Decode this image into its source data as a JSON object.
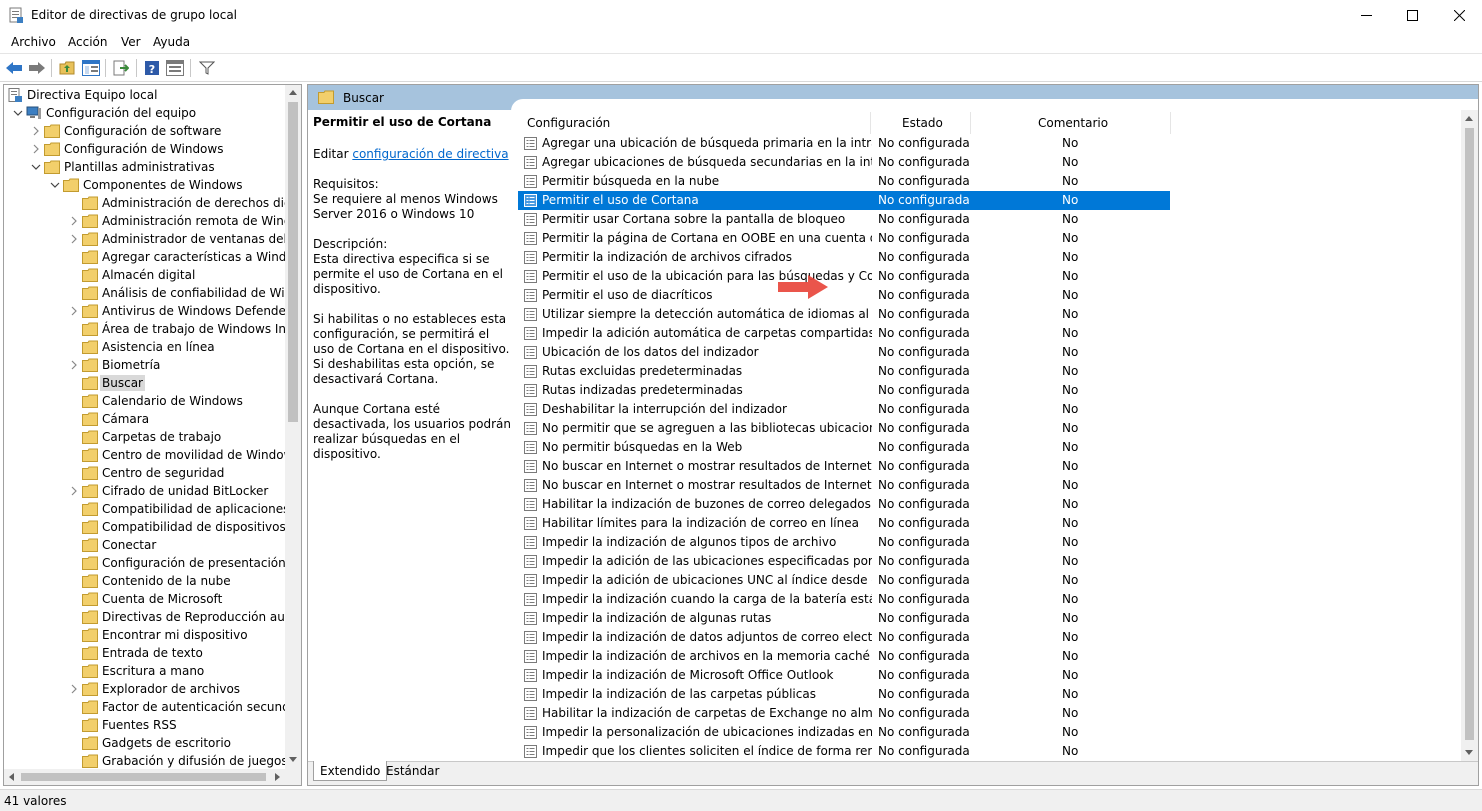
{
  "window": {
    "title": "Editor de directivas de grupo local"
  },
  "menu": [
    "Archivo",
    "Acción",
    "Ver",
    "Ayuda"
  ],
  "toolbar_icons": [
    "back-arrow-icon",
    "forward-arrow-icon",
    "folder-up-icon",
    "show-hide-tree-icon",
    "export-list-icon",
    "help-icon",
    "properties-icon",
    "filter-icon"
  ],
  "tree": {
    "items": [
      {
        "label": "Directiva Equipo local",
        "level": 0,
        "expander": "none",
        "icon": "computer-policy-icon"
      },
      {
        "label": "Configuración del equipo",
        "level": 1,
        "expander": "open",
        "icon": "computer-icon"
      },
      {
        "label": "Configuración de software",
        "level": 2,
        "expander": "closed",
        "icon": "folder-icon"
      },
      {
        "label": "Configuración de Windows",
        "level": 2,
        "expander": "closed",
        "icon": "folder-icon"
      },
      {
        "label": "Plantillas administrativas",
        "level": 2,
        "expander": "open",
        "icon": "folder-icon"
      },
      {
        "label": "Componentes de Windows",
        "level": 3,
        "expander": "open",
        "icon": "folder-icon"
      },
      {
        "label": "Administración de derechos digita",
        "level": 4,
        "expander": "none",
        "icon": "folder-icon"
      },
      {
        "label": "Administración remota de Window",
        "level": 4,
        "expander": "closed",
        "icon": "folder-icon"
      },
      {
        "label": "Administrador de ventanas del esc",
        "level": 4,
        "expander": "closed",
        "icon": "folder-icon"
      },
      {
        "label": "Agregar características a Windows",
        "level": 4,
        "expander": "none",
        "icon": "folder-icon"
      },
      {
        "label": "Almacén digital",
        "level": 4,
        "expander": "none",
        "icon": "folder-icon"
      },
      {
        "label": "Análisis de confiabilidad de Windo",
        "level": 4,
        "expander": "none",
        "icon": "folder-icon"
      },
      {
        "label": "Antivirus de Windows Defender",
        "level": 4,
        "expander": "closed",
        "icon": "folder-icon"
      },
      {
        "label": "Área de trabajo de Windows Ink",
        "level": 4,
        "expander": "none",
        "icon": "folder-icon"
      },
      {
        "label": "Asistencia en línea",
        "level": 4,
        "expander": "none",
        "icon": "folder-icon"
      },
      {
        "label": "Biometría",
        "level": 4,
        "expander": "closed",
        "icon": "folder-icon"
      },
      {
        "label": "Buscar",
        "level": 4,
        "expander": "none",
        "icon": "folder-icon",
        "selected": true
      },
      {
        "label": "Calendario de Windows",
        "level": 4,
        "expander": "none",
        "icon": "folder-icon"
      },
      {
        "label": "Cámara",
        "level": 4,
        "expander": "none",
        "icon": "folder-icon"
      },
      {
        "label": "Carpetas de trabajo",
        "level": 4,
        "expander": "none",
        "icon": "folder-icon"
      },
      {
        "label": "Centro de movilidad de Windows",
        "level": 4,
        "expander": "none",
        "icon": "folder-icon"
      },
      {
        "label": "Centro de seguridad",
        "level": 4,
        "expander": "none",
        "icon": "folder-icon"
      },
      {
        "label": "Cifrado de unidad BitLocker",
        "level": 4,
        "expander": "closed",
        "icon": "folder-icon"
      },
      {
        "label": "Compatibilidad de aplicaciones",
        "level": 4,
        "expander": "none",
        "icon": "folder-icon"
      },
      {
        "label": "Compatibilidad de dispositivos y c",
        "level": 4,
        "expander": "none",
        "icon": "folder-icon"
      },
      {
        "label": "Conectar",
        "level": 4,
        "expander": "none",
        "icon": "folder-icon"
      },
      {
        "label": "Configuración de presentación",
        "level": 4,
        "expander": "none",
        "icon": "folder-icon"
      },
      {
        "label": "Contenido de la nube",
        "level": 4,
        "expander": "none",
        "icon": "folder-icon"
      },
      {
        "label": "Cuenta de Microsoft",
        "level": 4,
        "expander": "none",
        "icon": "folder-icon"
      },
      {
        "label": "Directivas de Reproducción autom",
        "level": 4,
        "expander": "none",
        "icon": "folder-icon"
      },
      {
        "label": "Encontrar mi dispositivo",
        "level": 4,
        "expander": "none",
        "icon": "folder-icon"
      },
      {
        "label": "Entrada de texto",
        "level": 4,
        "expander": "none",
        "icon": "folder-icon"
      },
      {
        "label": "Escritura a mano",
        "level": 4,
        "expander": "none",
        "icon": "folder-icon"
      },
      {
        "label": "Explorador de archivos",
        "level": 4,
        "expander": "closed",
        "icon": "folder-icon"
      },
      {
        "label": "Factor de autenticación secundari",
        "level": 4,
        "expander": "none",
        "icon": "folder-icon"
      },
      {
        "label": "Fuentes RSS",
        "level": 4,
        "expander": "none",
        "icon": "folder-icon"
      },
      {
        "label": "Gadgets de escritorio",
        "level": 4,
        "expander": "none",
        "icon": "folder-icon"
      },
      {
        "label": "Grabación y difusión de juegos de",
        "level": 4,
        "expander": "none",
        "icon": "folder-icon"
      }
    ]
  },
  "right": {
    "header_title": "Buscar",
    "description": {
      "title": "Permitir el uso de Cortana",
      "edit_prefix": "Editar ",
      "edit_link": "configuración de directiva",
      "req_label": "Requisitos:",
      "req_text": "Se requiere al menos Windows Server 2016 o Windows 10",
      "desc_label": "Descripción:",
      "desc_text": "Esta directiva especifica si se permite el uso de Cortana en el dispositivo.",
      "desc_p2": "Si habilitas o no estableces esta configuración, se permitirá el uso de Cortana en el dispositivo. Si deshabilitas esta opción, se desactivará Cortana.",
      "desc_p3": "Aunque Cortana esté desactivada, los usuarios podrán realizar búsquedas en el dispositivo."
    },
    "columns": {
      "name": "Configuración",
      "state": "Estado",
      "comment": "Comentario"
    },
    "rows": [
      {
        "name": "Agregar una ubicación de búsqueda primaria en la intranet",
        "state": "No configurada",
        "comment": "No"
      },
      {
        "name": "Agregar ubicaciones de búsqueda secundarias en la intranet",
        "state": "No configurada",
        "comment": "No"
      },
      {
        "name": "Permitir búsqueda en la nube",
        "state": "No configurada",
        "comment": "No"
      },
      {
        "name": "Permitir el uso de Cortana",
        "state": "No configurada",
        "comment": "No",
        "selected": true
      },
      {
        "name": "Permitir usar Cortana sobre la pantalla de bloqueo",
        "state": "No configurada",
        "comment": "No"
      },
      {
        "name": "Permitir la página de Cortana en OOBE en una cuenta de AAD",
        "state": "No configurada",
        "comment": "No"
      },
      {
        "name": "Permitir la indización de archivos cifrados",
        "state": "No configurada",
        "comment": "No"
      },
      {
        "name": "Permitir el uso de la ubicación para las búsquedas y Cortana",
        "state": "No configurada",
        "comment": "No"
      },
      {
        "name": "Permitir el uso de diacríticos",
        "state": "No configurada",
        "comment": "No"
      },
      {
        "name": "Utilizar siempre la detección automática de idiomas al indiz...",
        "state": "No configurada",
        "comment": "No"
      },
      {
        "name": "Impedir la adición automática de carpetas compartidas al ín...",
        "state": "No configurada",
        "comment": "No"
      },
      {
        "name": "Ubicación de los datos del indizador",
        "state": "No configurada",
        "comment": "No"
      },
      {
        "name": "Rutas excluidas predeterminadas",
        "state": "No configurada",
        "comment": "No"
      },
      {
        "name": "Rutas indizadas predeterminadas",
        "state": "No configurada",
        "comment": "No"
      },
      {
        "name": "Deshabilitar la interrupción del indizador",
        "state": "No configurada",
        "comment": "No"
      },
      {
        "name": "No permitir que se agreguen a las bibliotecas ubicaciones e...",
        "state": "No configurada",
        "comment": "No"
      },
      {
        "name": "No permitir búsquedas en la Web",
        "state": "No configurada",
        "comment": "No"
      },
      {
        "name": "No buscar en Internet o mostrar resultados de Internet en Se...",
        "state": "No configurada",
        "comment": "No"
      },
      {
        "name": "No buscar en Internet o mostrar resultados de Internet en Se...",
        "state": "No configurada",
        "comment": "No"
      },
      {
        "name": "Habilitar la indización de buzones de correo delegados en lí...",
        "state": "No configurada",
        "comment": "No"
      },
      {
        "name": "Habilitar límites para la indización de correo en línea",
        "state": "No configurada",
        "comment": "No"
      },
      {
        "name": "Impedir la indización de algunos tipos de archivo",
        "state": "No configurada",
        "comment": "No"
      },
      {
        "name": "Impedir la adición de las ubicaciones especificadas por el us...",
        "state": "No configurada",
        "comment": "No"
      },
      {
        "name": "Impedir la adición de ubicaciones UNC al índice desde el Pa...",
        "state": "No configurada",
        "comment": "No"
      },
      {
        "name": "Impedir la indización cuando la carga de la batería está en ej...",
        "state": "No configurada",
        "comment": "No"
      },
      {
        "name": "Impedir la indización de algunas rutas",
        "state": "No configurada",
        "comment": "No"
      },
      {
        "name": "Impedir la indización de datos adjuntos de correo electrónico",
        "state": "No configurada",
        "comment": "No"
      },
      {
        "name": "Impedir la indización de archivos en la memoria caché de ar...",
        "state": "No configurada",
        "comment": "No"
      },
      {
        "name": "Impedir la indización de Microsoft Office Outlook",
        "state": "No configurada",
        "comment": "No"
      },
      {
        "name": "Impedir la indización de las carpetas públicas",
        "state": "No configurada",
        "comment": "No"
      },
      {
        "name": "Habilitar la indización de carpetas de Exchange no almacena...",
        "state": "No configurada",
        "comment": "No"
      },
      {
        "name": "Impedir la personalización de ubicaciones indizadas en el Pa...",
        "state": "No configurada",
        "comment": "No"
      },
      {
        "name": "Impedir que los clientes soliciten el índice de forma remota",
        "state": "No configurada",
        "comment": "No"
      }
    ],
    "tabs": [
      "Extendido",
      "Estándar"
    ]
  },
  "status": {
    "text": "41 valores"
  },
  "colors": {
    "selection": "#0078d7",
    "header_band": "#a6c3dd",
    "link": "#0066cc",
    "arrow": "#e8473c"
  }
}
